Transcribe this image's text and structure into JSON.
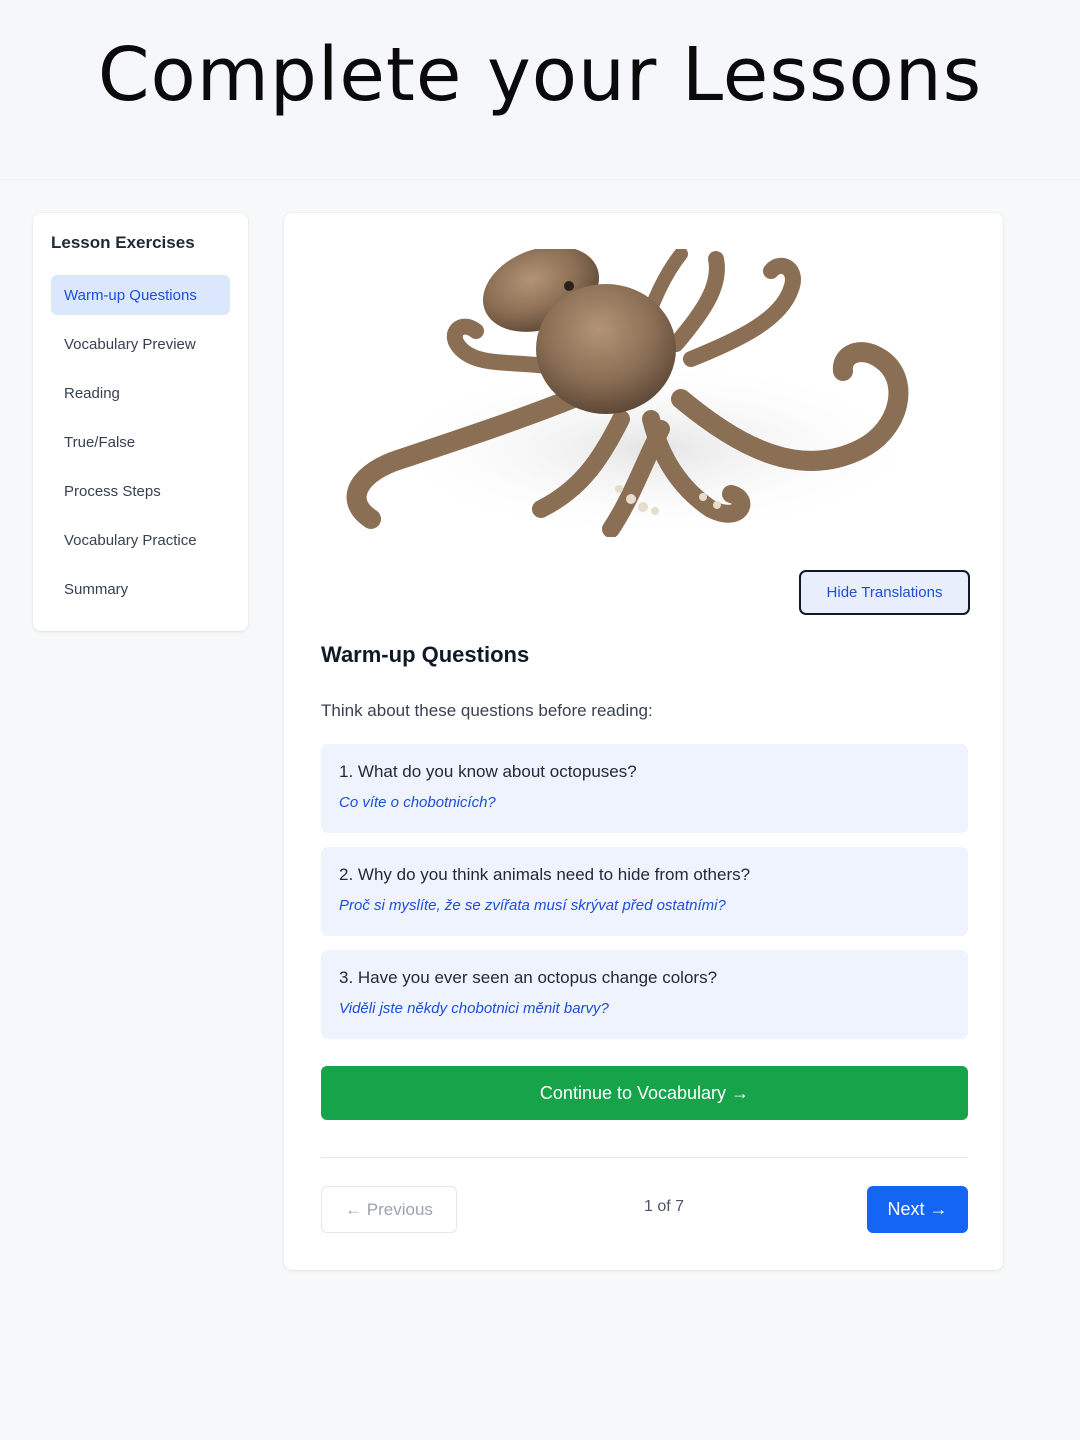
{
  "banner": {
    "title": "Complete your Lessons"
  },
  "sidebar": {
    "title": "Lesson Exercises",
    "items": [
      {
        "label": "Warm-up Questions",
        "active": true
      },
      {
        "label": "Vocabulary Preview",
        "active": false
      },
      {
        "label": "Reading",
        "active": false
      },
      {
        "label": "True/False",
        "active": false
      },
      {
        "label": "Process Steps",
        "active": false
      },
      {
        "label": "Vocabulary Practice",
        "active": false
      },
      {
        "label": "Summary",
        "active": false
      }
    ]
  },
  "main": {
    "hide_translations_label": "Hide Translations",
    "section_title": "Warm-up Questions",
    "intro": "Think about these questions before reading:",
    "questions": [
      {
        "en": "1. What do you know about octopuses?",
        "cs": "Co víte o chobotnicích?"
      },
      {
        "en": "2. Why do you think animals need to hide from others?",
        "cs": "Proč si myslíte, že se zvířata musí skrývat před ostatními?"
      },
      {
        "en": "3. Have you ever seen an octopus change colors?",
        "cs": "Viděli jste někdy chobotnici měnit barvy?"
      }
    ],
    "continue_label": "Continue to Vocabulary →",
    "pagination": {
      "previous_label": "← Previous",
      "counter": "1 of 7",
      "next_label": "Next →"
    }
  },
  "colors": {
    "accent_blue": "#1565f5",
    "active_bg": "#dbe7fd",
    "question_bg": "#eef3fd",
    "continue_green": "#16a34a",
    "octopus_brown": "#8b6f55"
  }
}
